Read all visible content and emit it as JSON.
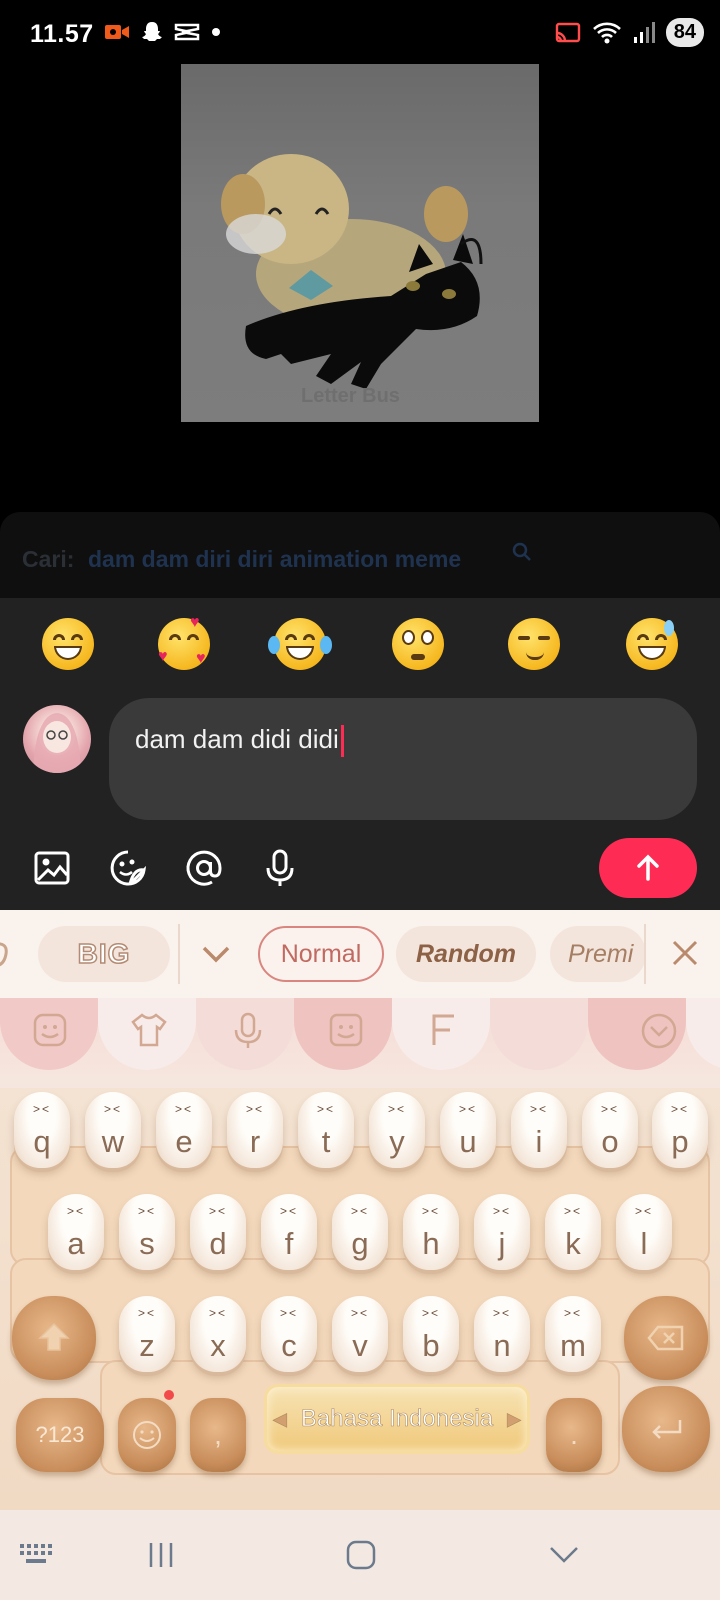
{
  "status_bar": {
    "time": "11.57",
    "battery": "84",
    "left_icons": [
      "video-record-icon",
      "snapchat-icon",
      "capcut-icon",
      "dot-icon"
    ],
    "right_icons": [
      "cast-icon",
      "wifi-icon",
      "signal-icon"
    ]
  },
  "video": {
    "watermark": "Letter Bus"
  },
  "search": {
    "prefix": "Cari:",
    "query": "dam dam diri diri animation meme"
  },
  "emojis": [
    "grinning-face",
    "smiling-face-with-hearts",
    "tears-of-joy",
    "flushed-face",
    "smirking-face",
    "grinning-sweat"
  ],
  "composer": {
    "input_value": "dam dam didi didi",
    "tools": [
      "image-icon",
      "sticker-icon",
      "mention-icon",
      "microphone-icon"
    ],
    "send_icon": "arrow-up-icon",
    "accent_color": "#fe2c55"
  },
  "keyboard": {
    "font_chips": {
      "big": "BIG",
      "normal": "Normal",
      "random": "Random",
      "premium": "Premi"
    },
    "func_icons": [
      "emoji-icon",
      "theme-shirt-icon",
      "microphone-icon",
      "sticker-face-icon",
      "font-icon",
      "collapse-icon"
    ],
    "rows": [
      [
        "q",
        "w",
        "e",
        "r",
        "t",
        "y",
        "u",
        "i",
        "o",
        "p"
      ],
      [
        "a",
        "s",
        "d",
        "f",
        "g",
        "h",
        "j",
        "k",
        "l"
      ],
      [
        "z",
        "x",
        "c",
        "v",
        "b",
        "n",
        "m"
      ]
    ],
    "face": "><",
    "symbols_key": "?123",
    "comma_key": ",",
    "space_label": "Bahasa Indonesia",
    "period_key": "."
  },
  "nav_bar": {
    "icons": [
      "keyboard-switch-icon",
      "recents-icon",
      "home-icon",
      "back-down-icon"
    ]
  }
}
